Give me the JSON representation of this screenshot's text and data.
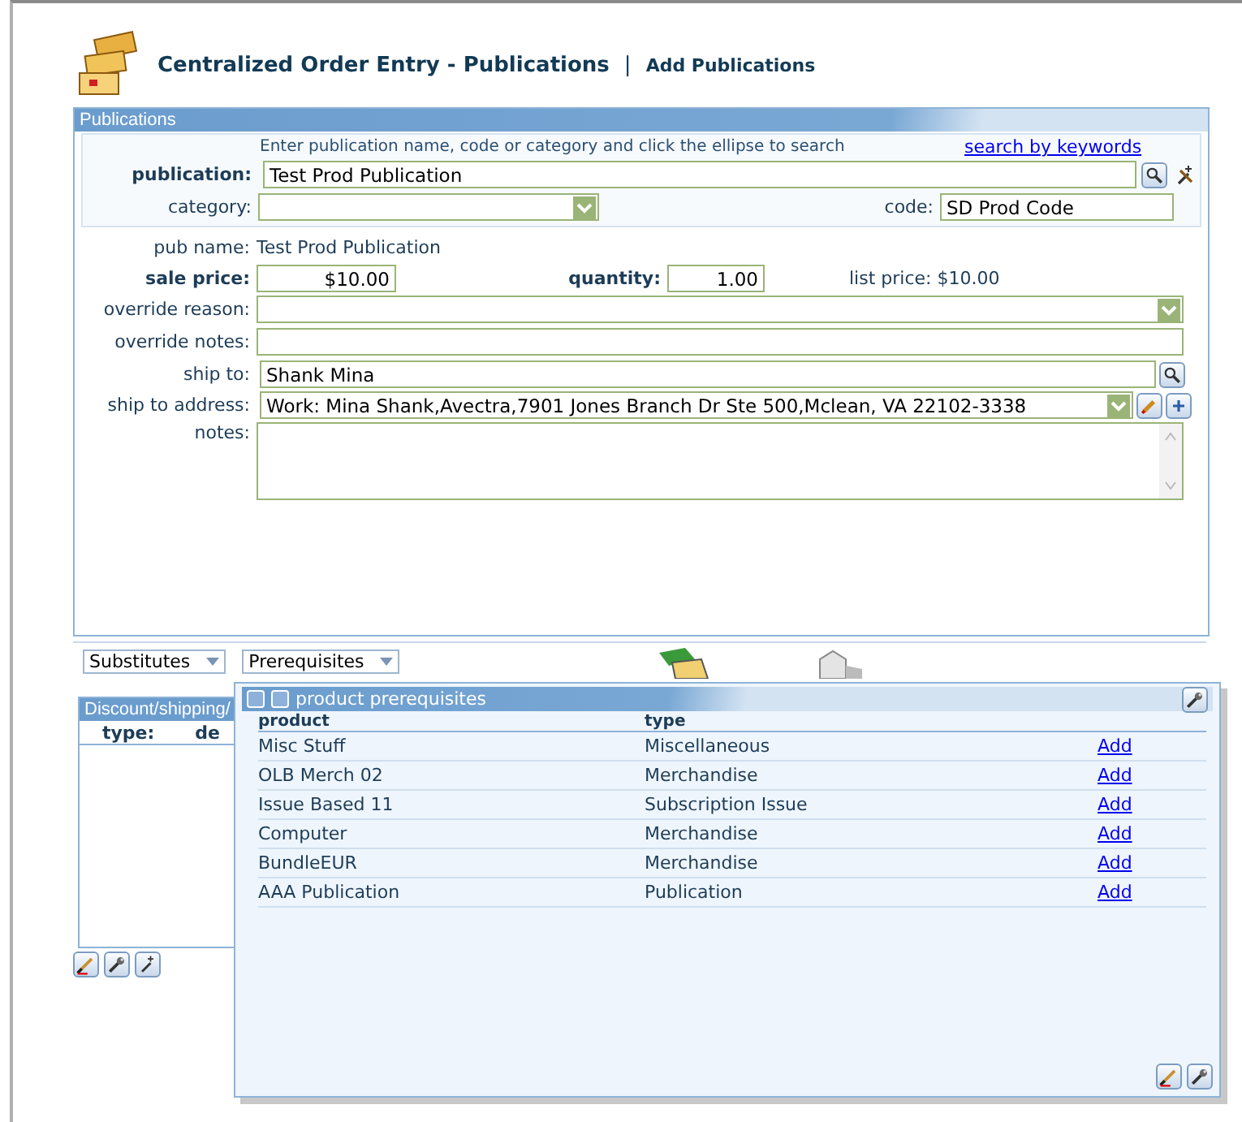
{
  "header": {
    "title": "Centralized Order Entry - Publications",
    "separator": "|",
    "subtitle": "Add Publications"
  },
  "publications_panel": {
    "title": "Publications",
    "hint": "Enter publication name, code or category and click the ellipse to search",
    "search_link": "search by keywords",
    "publication": {
      "label": "publication:",
      "value": "Test Prod Publication"
    },
    "category": {
      "label": "category:"
    },
    "code": {
      "label": "code:",
      "value": "SD Prod Code"
    },
    "pub_name": {
      "label": "pub name:",
      "value": "Test Prod Publication"
    },
    "sale_price": {
      "label": "sale price:",
      "value": "$10.00"
    },
    "quantity": {
      "label": "quantity:",
      "value": "1.00"
    },
    "list_price": {
      "label": "list price:",
      "value": "$10.00"
    },
    "override_reason": {
      "label": "override reason:"
    },
    "override_notes": {
      "label": "override notes:"
    },
    "ship_to": {
      "label": "ship to:",
      "value": "Shank Mina"
    },
    "ship_to_address": {
      "label": "ship to address:",
      "value": "Work: Mina Shank,Avectra,7901 Jones Branch Dr Ste 500,Mclean, VA 22102-3338"
    },
    "notes": {
      "label": "notes:"
    }
  },
  "dropdowns": [
    {
      "label": "Substitutes"
    },
    {
      "label": "Prerequisites"
    }
  ],
  "discount_panel": {
    "title": "Discount/shipping/",
    "columns": [
      "type:",
      "de"
    ]
  },
  "popup": {
    "title": "product prerequisites",
    "columns": [
      "product",
      "type"
    ],
    "rows": [
      {
        "product": "Misc Stuff",
        "type": "Miscellaneous",
        "action": "Add"
      },
      {
        "product": "OLB Merch 02",
        "type": "Merchandise",
        "action": "Add"
      },
      {
        "product": "Issue Based 11",
        "type": "Subscription Issue",
        "action": "Add"
      },
      {
        "product": "Computer",
        "type": "Merchandise",
        "action": "Add"
      },
      {
        "product": "BundleEUR",
        "type": "Merchandise",
        "action": "Add"
      },
      {
        "product": "AAA Publication",
        "type": "Publication",
        "action": "Add"
      }
    ]
  }
}
